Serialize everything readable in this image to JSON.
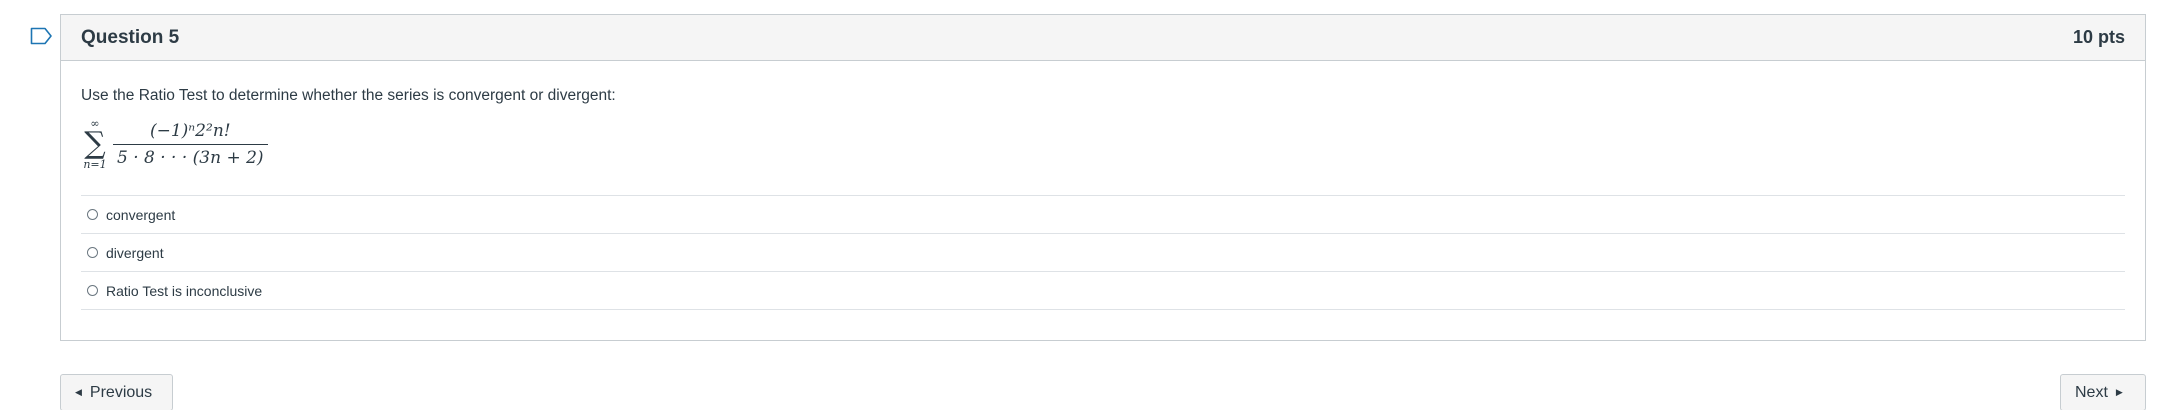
{
  "question": {
    "title": "Question 5",
    "points": "10 pts",
    "prompt": "Use the Ratio Test to determine whether the series is convergent or divergent:",
    "formula": {
      "sum_upper": "∞",
      "sum_symbol": "∑",
      "sum_lower": "n=1",
      "numerator": "(−1)ⁿ2²n!",
      "denominator": "5 · 8 · · · (3n + 2)"
    },
    "answers": [
      {
        "label": "convergent",
        "selected": false
      },
      {
        "label": "divergent",
        "selected": false
      },
      {
        "label": "Ratio Test is inconclusive",
        "selected": false
      }
    ]
  },
  "navigation": {
    "previous_label": "Previous",
    "next_label": "Next",
    "previous_icon": "caret-left-icon",
    "next_icon": "caret-right-icon"
  },
  "icons": {
    "bookmark": "bookmark-icon"
  },
  "colors": {
    "text": "#2d3b45",
    "header_bg": "#f5f5f5",
    "border": "#c7cdd1",
    "bookmark": "#1d75b3"
  }
}
